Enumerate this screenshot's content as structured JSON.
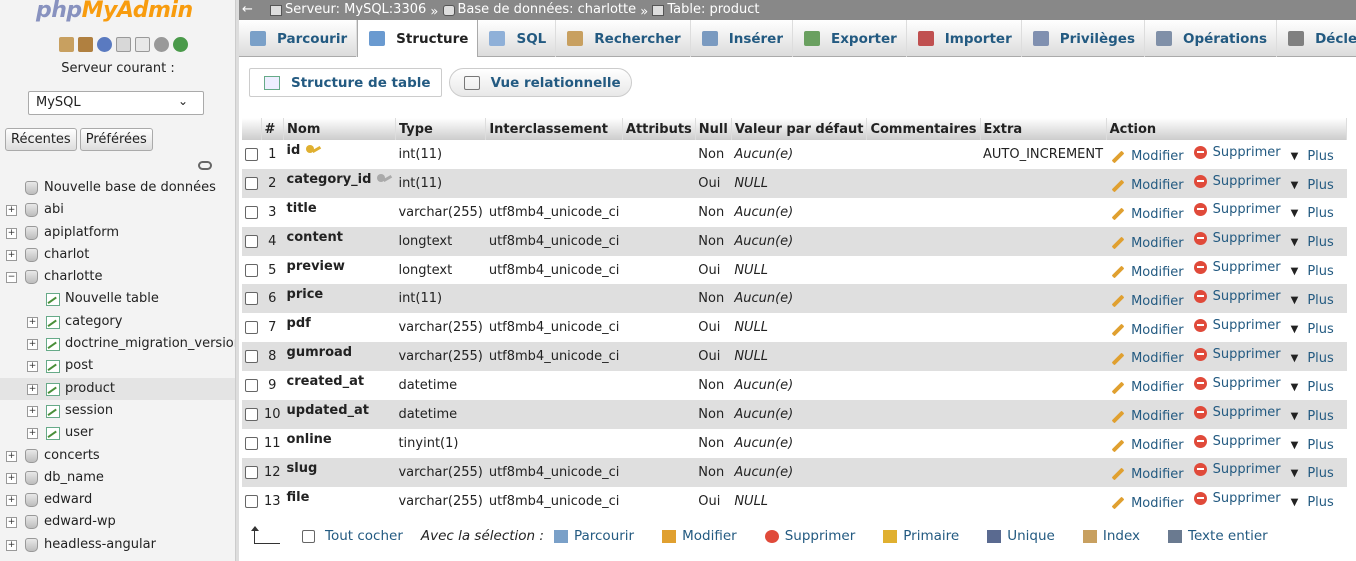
{
  "nav": {
    "logo_php": "php",
    "logo_myadmin": "MyAdmin",
    "tool_icons": [
      "home-icon",
      "exit-icon",
      "help-icon",
      "docs-icon",
      "copy-icon",
      "settings-icon",
      "reload-icon"
    ],
    "serveur_label": "Serveur courant :",
    "serveur_select": "MySQL",
    "tabs": [
      "Récentes",
      "Préférées"
    ],
    "tree": [
      {
        "label": "Nouvelle base de données",
        "level": 0,
        "kind": "new-db"
      },
      {
        "label": "abi",
        "level": 0,
        "kind": "db",
        "expander": "+"
      },
      {
        "label": "apiplatform",
        "level": 0,
        "kind": "db",
        "expander": "+"
      },
      {
        "label": "charlot",
        "level": 0,
        "kind": "db",
        "expander": "+"
      },
      {
        "label": "charlotte",
        "level": 0,
        "kind": "db",
        "expander": "−"
      },
      {
        "label": "Nouvelle table",
        "level": 1,
        "kind": "new-table"
      },
      {
        "label": "category",
        "level": 1,
        "kind": "table",
        "expander": "+"
      },
      {
        "label": "doctrine_migration_versions",
        "level": 1,
        "kind": "table",
        "expander": "+"
      },
      {
        "label": "post",
        "level": 1,
        "kind": "table",
        "expander": "+"
      },
      {
        "label": "product",
        "level": 1,
        "kind": "table",
        "expander": "+",
        "selected": true
      },
      {
        "label": "session",
        "level": 1,
        "kind": "table",
        "expander": "+"
      },
      {
        "label": "user",
        "level": 1,
        "kind": "table",
        "expander": "+"
      },
      {
        "label": "concerts",
        "level": 0,
        "kind": "db",
        "expander": "+"
      },
      {
        "label": "db_name",
        "level": 0,
        "kind": "db",
        "expander": "+"
      },
      {
        "label": "edward",
        "level": 0,
        "kind": "db",
        "expander": "+"
      },
      {
        "label": "edward-wp",
        "level": 0,
        "kind": "db",
        "expander": "+"
      },
      {
        "label": "headless-angular",
        "level": 0,
        "kind": "db",
        "expander": "+"
      }
    ]
  },
  "breadcrumb": {
    "back": "←",
    "server": "Serveur: MySQL:3306",
    "sep": "»",
    "database": "Base de données: charlotte",
    "table": "Table: product"
  },
  "tabs": [
    {
      "label": "Parcourir",
      "icon": "browse-icon",
      "color": "#7aa0c8"
    },
    {
      "label": "Structure",
      "icon": "structure-icon",
      "color": "#6a9ad0",
      "active": true
    },
    {
      "label": "SQL",
      "icon": "sql-icon",
      "color": "#8fb0d8"
    },
    {
      "label": "Rechercher",
      "icon": "search-icon",
      "color": "#c8a060"
    },
    {
      "label": "Insérer",
      "icon": "insert-icon",
      "color": "#7a9ac0"
    },
    {
      "label": "Exporter",
      "icon": "export-icon",
      "color": "#6aa060"
    },
    {
      "label": "Importer",
      "icon": "import-icon",
      "color": "#c05050"
    },
    {
      "label": "Privilèges",
      "icon": "privileges-icon",
      "color": "#8090b0"
    },
    {
      "label": "Opérations",
      "icon": "operations-icon",
      "color": "#8090a8"
    },
    {
      "label": "Déclencheurs",
      "icon": "triggers-icon",
      "color": "#808080"
    }
  ],
  "subtabs": [
    "Structure de table",
    "Vue relationnelle"
  ],
  "table": {
    "headers": [
      "",
      "#",
      "Nom",
      "Type",
      "Interclassement",
      "Attributs",
      "Null",
      "Valeur par défaut",
      "Commentaires",
      "Extra",
      "Action"
    ],
    "rows": [
      {
        "n": "1",
        "name": "id",
        "key": "primary",
        "type": "int(11)",
        "coll": "",
        "attr": "",
        "null": "Non",
        "default": "Aucun(e)",
        "comments": "",
        "extra": "AUTO_INCREMENT"
      },
      {
        "n": "2",
        "name": "category_id",
        "key": "index",
        "type": "int(11)",
        "coll": "",
        "attr": "",
        "null": "Oui",
        "default": "NULL",
        "comments": "",
        "extra": ""
      },
      {
        "n": "3",
        "name": "title",
        "key": "",
        "type": "varchar(255)",
        "coll": "utf8mb4_unicode_ci",
        "attr": "",
        "null": "Non",
        "default": "Aucun(e)",
        "comments": "",
        "extra": ""
      },
      {
        "n": "4",
        "name": "content",
        "key": "",
        "type": "longtext",
        "coll": "utf8mb4_unicode_ci",
        "attr": "",
        "null": "Non",
        "default": "Aucun(e)",
        "comments": "",
        "extra": ""
      },
      {
        "n": "5",
        "name": "preview",
        "key": "",
        "type": "longtext",
        "coll": "utf8mb4_unicode_ci",
        "attr": "",
        "null": "Oui",
        "default": "NULL",
        "comments": "",
        "extra": ""
      },
      {
        "n": "6",
        "name": "price",
        "key": "",
        "type": "int(11)",
        "coll": "",
        "attr": "",
        "null": "Non",
        "default": "Aucun(e)",
        "comments": "",
        "extra": ""
      },
      {
        "n": "7",
        "name": "pdf",
        "key": "",
        "type": "varchar(255)",
        "coll": "utf8mb4_unicode_ci",
        "attr": "",
        "null": "Oui",
        "default": "NULL",
        "comments": "",
        "extra": ""
      },
      {
        "n": "8",
        "name": "gumroad",
        "key": "",
        "type": "varchar(255)",
        "coll": "utf8mb4_unicode_ci",
        "attr": "",
        "null": "Oui",
        "default": "NULL",
        "comments": "",
        "extra": ""
      },
      {
        "n": "9",
        "name": "created_at",
        "key": "",
        "type": "datetime",
        "coll": "",
        "attr": "",
        "null": "Non",
        "default": "Aucun(e)",
        "comments": "",
        "extra": ""
      },
      {
        "n": "10",
        "name": "updated_at",
        "key": "",
        "type": "datetime",
        "coll": "",
        "attr": "",
        "null": "Non",
        "default": "Aucun(e)",
        "comments": "",
        "extra": ""
      },
      {
        "n": "11",
        "name": "online",
        "key": "",
        "type": "tinyint(1)",
        "coll": "",
        "attr": "",
        "null": "Non",
        "default": "Aucun(e)",
        "comments": "",
        "extra": ""
      },
      {
        "n": "12",
        "name": "slug",
        "key": "",
        "type": "varchar(255)",
        "coll": "utf8mb4_unicode_ci",
        "attr": "",
        "null": "Non",
        "default": "Aucun(e)",
        "comments": "",
        "extra": ""
      },
      {
        "n": "13",
        "name": "file",
        "key": "",
        "type": "varchar(255)",
        "coll": "utf8mb4_unicode_ci",
        "attr": "",
        "null": "Oui",
        "default": "NULL",
        "comments": "",
        "extra": ""
      }
    ],
    "actions": {
      "modify": "Modifier",
      "delete": "Supprimer",
      "more": "Plus"
    }
  },
  "footer": {
    "check_all": "Tout cocher",
    "with_selection": "Avec la sélection :",
    "actions": [
      {
        "label": "Parcourir",
        "icon": "browse-icon"
      },
      {
        "label": "Modifier",
        "icon": "pencil-icon"
      },
      {
        "label": "Supprimer",
        "icon": "delete-icon"
      },
      {
        "label": "Primaire",
        "icon": "primary-key-icon"
      },
      {
        "label": "Unique",
        "icon": "unique-icon"
      },
      {
        "label": "Index",
        "icon": "index-icon"
      },
      {
        "label": "Texte entier",
        "icon": "fulltext-icon"
      }
    ]
  }
}
